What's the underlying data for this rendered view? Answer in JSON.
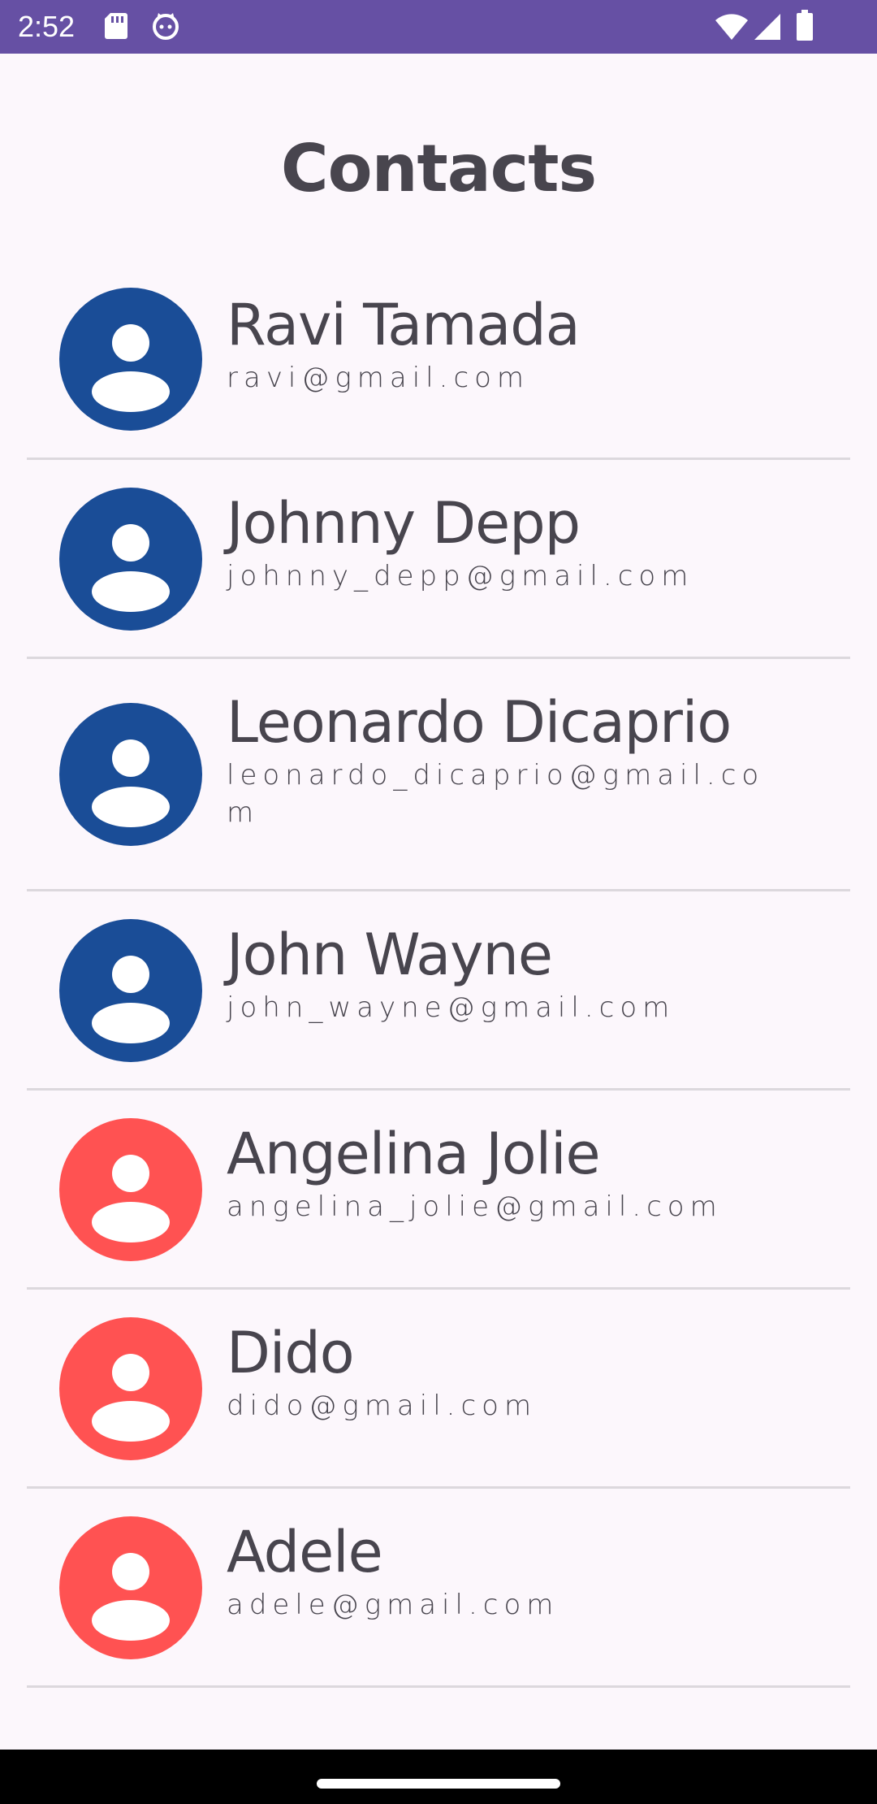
{
  "status_bar": {
    "time": "2:52",
    "background": "#6650a4",
    "icons": [
      "sd-card-icon",
      "notification-cat-icon",
      "wifi-icon",
      "signal-icon",
      "battery-icon"
    ]
  },
  "page": {
    "title": "Contacts"
  },
  "colors": {
    "male_avatar": "#1a4d97",
    "female_avatar": "#ff5252",
    "text": "#48454e",
    "divider": "#dcd8dd"
  },
  "contacts": [
    {
      "name": "Ravi Tamada",
      "email": "ravi@gmail.com",
      "avatar_color": "#1a4d97"
    },
    {
      "name": "Johnny Depp",
      "email": "johnny_depp@gmail.com",
      "avatar_color": "#1a4d97"
    },
    {
      "name": "Leonardo Dicaprio",
      "email": "leonardo_dicaprio@gmail.com",
      "avatar_color": "#1a4d97"
    },
    {
      "name": "John Wayne",
      "email": "john_wayne@gmail.com",
      "avatar_color": "#1a4d97"
    },
    {
      "name": "Angelina Jolie",
      "email": "angelina_jolie@gmail.com",
      "avatar_color": "#ff5252"
    },
    {
      "name": "Dido",
      "email": "dido@gmail.com",
      "avatar_color": "#ff5252"
    },
    {
      "name": "Adele",
      "email": "adele@gmail.com",
      "avatar_color": "#ff5252"
    }
  ]
}
